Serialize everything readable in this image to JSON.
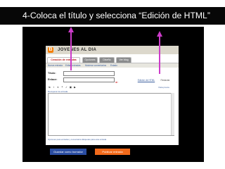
{
  "slide": {
    "instruction": "4-Coloca el título y selecciona “Edición de HTML”"
  },
  "blog": {
    "logo_letter": "B",
    "name": "JOVENES AL DIA"
  },
  "tabs": [
    {
      "label": "Creación de entradas",
      "active": true
    },
    {
      "label": "Opciones",
      "active": false
    },
    {
      "label": "Diseño",
      "active": false
    },
    {
      "label": "Ver blog",
      "active": false
    }
  ],
  "subtabs": [
    "Nueva entrada",
    "Editar entradas",
    "Moderar comentarios",
    "Estado"
  ],
  "form": {
    "title_label": "Título:",
    "link_label": "Enlace:",
    "title_value": "",
    "link_value": ""
  },
  "editor_modes": {
    "html_label": "Edición de HTML",
    "compose_label": "Redactar"
  },
  "toolbar": {
    "icons": [
      "bold-icon",
      "italic-icon",
      "link-icon",
      "quote-icon",
      "spellcheck-icon",
      "image-icon",
      "video-icon"
    ],
    "glyphs": [
      "b",
      "i",
      "❧",
      "❝",
      "✓",
      "▣",
      "▶"
    ],
    "right_link": "Vista previa"
  },
  "editor": {
    "caption": "Recuperar la entrada"
  },
  "status": {
    "text": "Opciones para entradas y comentarios    Etiquetas para esta entrada"
  },
  "buttons": {
    "save": "Guardar como borrador",
    "publish": "Publicar entrada"
  },
  "colors": {
    "arrow": "#cc3bc9",
    "publish": "#f26a1b",
    "save": "#2b4ea3"
  }
}
